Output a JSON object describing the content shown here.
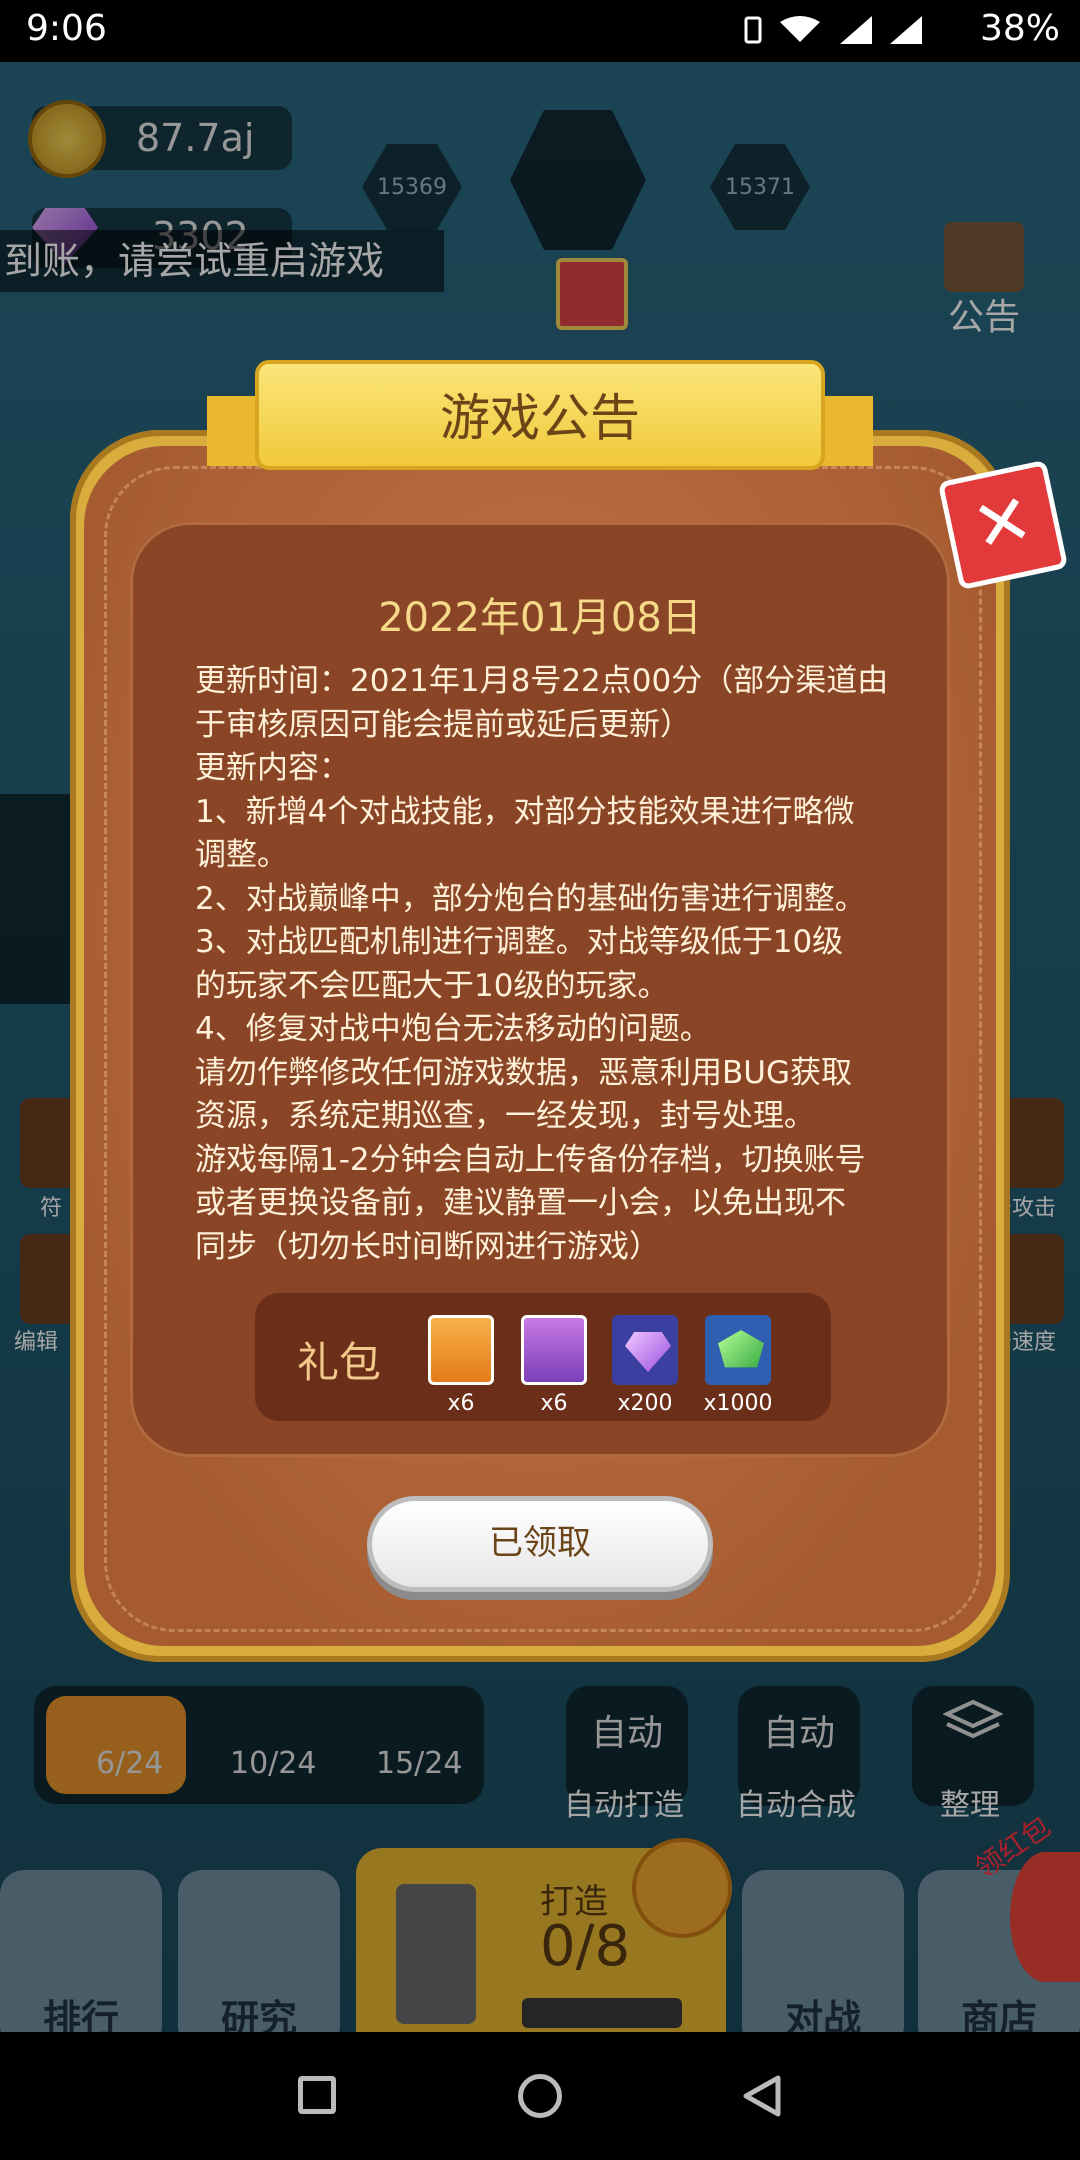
{
  "status_bar": {
    "time": "9:06",
    "battery": "38%"
  },
  "hud": {
    "coins": "87.7aj",
    "gems": "3302",
    "level_prev": "15369",
    "level_next": "15371",
    "notice_label": "公告",
    "scroll_text": "到账，请尝试重启游戏",
    "side_labels": {
      "left1": "符",
      "left2": "编辑",
      "right1": "击攻击",
      "right2": "击速度"
    }
  },
  "bottom": {
    "counters": [
      "6/24",
      "10/24",
      "15/24"
    ],
    "auto_build": {
      "title": "自动",
      "label": "自动打造"
    },
    "auto_merge": {
      "title": "自动",
      "label": "自动合成"
    },
    "organize": "整理",
    "tabs": {
      "rank": "排行",
      "research": "研究",
      "battle": "对战",
      "shop": "商店"
    },
    "forge": {
      "label": "打造",
      "count": "0/8"
    },
    "red_packet": "领红包"
  },
  "dialog": {
    "title": "游戏公告",
    "date": "2022年01月08日",
    "lines": [
      "更新时间：2021年1月8号22点00分（部分渠道由",
      "于审核原因可能会提前或延后更新）",
      "更新内容：",
      "1、新增4个对战技能，对部分技能效果进行略微",
      "调整。",
      "2、对战巅峰中，部分炮台的基础伤害进行调整。",
      "3、对战匹配机制进行调整。对战等级低于10级",
      "的玩家不会匹配大于10级的玩家。",
      "4、修复对战中炮台无法移动的问题。",
      "请勿作弊修改任何游戏数据，恶意利用BUG获取",
      "资源，系统定期巡查，一经发现，封号处理。",
      "游戏每隔1-2分钟会自动上传备份存档，切换账号",
      "或者更换设备前，建议静置一小会，以免出现不",
      "同步（切勿长时间断网进行游戏）"
    ],
    "gift": {
      "label": "礼包",
      "items": [
        {
          "icon": "orange-potion-icon",
          "count": "x6"
        },
        {
          "icon": "purple-potion-icon",
          "count": "x6"
        },
        {
          "icon": "purple-gem-icon",
          "count": "x200"
        },
        {
          "icon": "green-gem-icon",
          "count": "x1000"
        }
      ]
    },
    "claimed_button": "已领取",
    "close_symbol": "✕"
  }
}
